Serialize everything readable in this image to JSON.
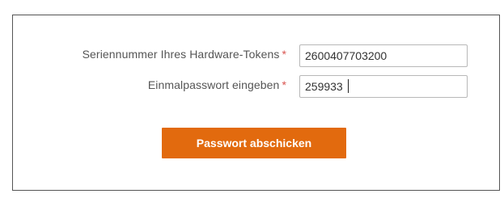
{
  "form": {
    "serial": {
      "label": "Seriennummer Ihres Hardware-Tokens",
      "required_marker": "*",
      "value": "2600407703200"
    },
    "otp": {
      "label": "Einmalpasswort eingeben",
      "required_marker": "*",
      "value": "259933"
    },
    "submit_label": "Passwort abschicken"
  },
  "colors": {
    "accent": "#e26a0e",
    "required": "#d9534f",
    "border": "#555555"
  }
}
